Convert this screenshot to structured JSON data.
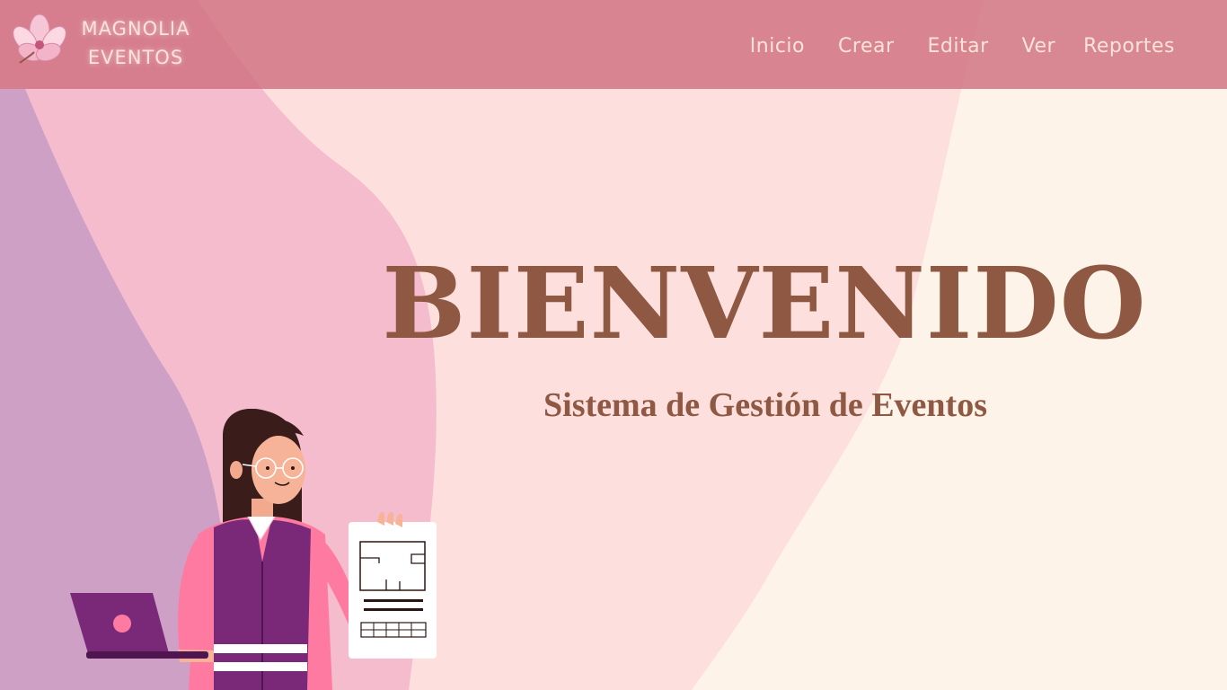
{
  "brand": {
    "line1": "MAGNOLIA",
    "line2": "EVENTOS",
    "logo_icon": "magnolia-flower-icon"
  },
  "nav": {
    "items": [
      {
        "label": "Inicio"
      },
      {
        "label": "Crear"
      },
      {
        "label": "Editar"
      },
      {
        "label": "Ver"
      },
      {
        "label": "Reportes"
      }
    ]
  },
  "hero": {
    "title": "BIENVENIDO",
    "subtitle": "Sistema de Gestión de Eventos"
  },
  "colors": {
    "navbar": "#d07080",
    "nav_text": "#fde3d8",
    "title": "#8e5843",
    "bg_cream": "#fef3e8",
    "bg_blush": "#fde0dd",
    "bg_pink": "#f4bccd",
    "bg_lilac": "#cea0c6"
  }
}
